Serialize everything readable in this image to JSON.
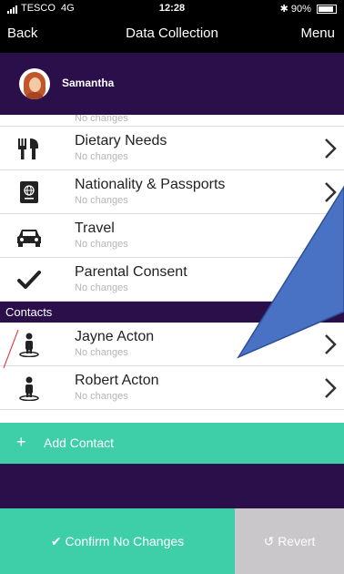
{
  "status": {
    "carrier": "TESCO",
    "network": "4G",
    "time": "12:28",
    "battery": "90%",
    "battery_level": 0.9
  },
  "nav": {
    "back": "Back",
    "title": "Data Collection",
    "menu": "Menu"
  },
  "user": {
    "name": "Samantha"
  },
  "rows": [
    {
      "sub": "No changes",
      "icon": "partial-icon"
    },
    {
      "label": "Dietary Needs",
      "sub": "No changes",
      "icon": "knife-fork-icon"
    },
    {
      "label": "Nationality & Passports",
      "sub": "No changes",
      "icon": "passport-icon"
    },
    {
      "label": "Travel",
      "sub": "No changes",
      "icon": "car-icon"
    },
    {
      "label": "Parental Consent",
      "sub": "No changes",
      "icon": "checkmark-icon"
    }
  ],
  "section": {
    "label": "Contacts"
  },
  "contacts": [
    {
      "label": "Jayne Acton",
      "sub": "No changes",
      "icon": "person-icon"
    },
    {
      "label": "Robert Acton",
      "sub": "No changes",
      "icon": "person-icon"
    }
  ],
  "add_contact": {
    "plus": "+",
    "label": "Add Contact"
  },
  "footer": {
    "confirm": "Confirm No Changes",
    "revert": "Revert"
  },
  "colors": {
    "purple": "#2a0f4a",
    "teal": "#3ecfa8",
    "gray": "#c9c7c9",
    "callout": "#4a72c4"
  }
}
